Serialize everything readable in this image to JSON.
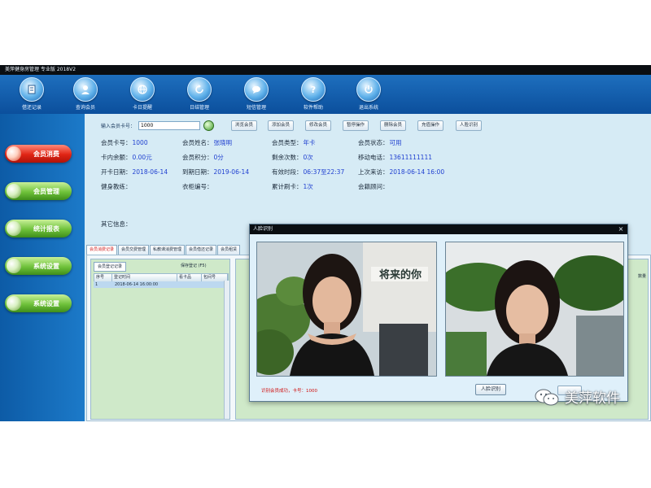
{
  "window": {
    "title": "美萍健身房管理 专业版 2018V2"
  },
  "toolbar": {
    "items": [
      {
        "label": "借还记录",
        "icon": "book-icon"
      },
      {
        "label": "查询会员",
        "icon": "user-search-icon"
      },
      {
        "label": "卡日提醒",
        "icon": "globe-icon"
      },
      {
        "label": "日结管理",
        "icon": "refresh-icon"
      },
      {
        "label": "短信管理",
        "icon": "chat-icon"
      },
      {
        "label": "软件帮助",
        "icon": "help-icon"
      },
      {
        "label": "退出系统",
        "icon": "power-icon"
      }
    ]
  },
  "sidebar": {
    "items": [
      {
        "label": "会员消费",
        "color": "red"
      },
      {
        "label": "会员管理",
        "color": "green"
      },
      {
        "label": "统计报表",
        "color": "green"
      },
      {
        "label": "系统设置",
        "color": "green"
      },
      {
        "label": "系统设置",
        "color": "green"
      }
    ]
  },
  "search": {
    "label": "输入会员卡号：",
    "value": "1000"
  },
  "actions": [
    "浏览会员",
    "添加会员",
    "修改会员",
    "暂停操作",
    "删除会员",
    "充值操作",
    "人脸识别"
  ],
  "member": {
    "rows": [
      [
        {
          "label": "会员卡号：",
          "value": "1000"
        },
        {
          "label": "会员姓名：",
          "value": "张晓明"
        },
        {
          "label": "会员类型：",
          "value": "年卡"
        },
        {
          "label": "会员状态：",
          "value": "可用"
        }
      ],
      [
        {
          "label": "卡内余额：",
          "value": "0.00元"
        },
        {
          "label": "会员积分：",
          "value": "0分"
        },
        {
          "label": "剩余次数：",
          "value": "0次"
        },
        {
          "label": "移动电话：",
          "value": "13611111111"
        }
      ],
      [
        {
          "label": "开卡日期：",
          "value": "2018-06-14"
        },
        {
          "label": "到期日期：",
          "value": "2019-06-14"
        },
        {
          "label": "有效时段：",
          "value": "06:37至22:37"
        },
        {
          "label": "上次来访：",
          "value": "2018-06-14 16:00"
        }
      ],
      [
        {
          "label": "健身教练：",
          "value": ""
        },
        {
          "label": "衣柜编号：",
          "value": ""
        },
        {
          "label": "累计刷卡：",
          "value": "1次"
        },
        {
          "label": "会籍顾问：",
          "value": ""
        }
      ]
    ],
    "other_label": "其它信息："
  },
  "tabs": [
    "会员消费记录",
    "会员交费管理",
    "私教课消费管理",
    "会员借还记录",
    "会员租赁"
  ],
  "grid": {
    "subtab": "会员登记记录",
    "save_label": "保存登记 (F5)",
    "columns": [
      "序号",
      "登记时间",
      "看卡品",
      "包间号"
    ],
    "rows": [
      [
        "1",
        "2018-06-14 16:00:00",
        "",
        ""
      ]
    ],
    "right_header": "数量"
  },
  "dialog": {
    "title": "人脸识别",
    "close": "×",
    "message": "识别会员成功，卡号：1000",
    "button": "人脸识别",
    "poster_text": "将来的你"
  },
  "watermark": {
    "text": "美萍软件"
  }
}
